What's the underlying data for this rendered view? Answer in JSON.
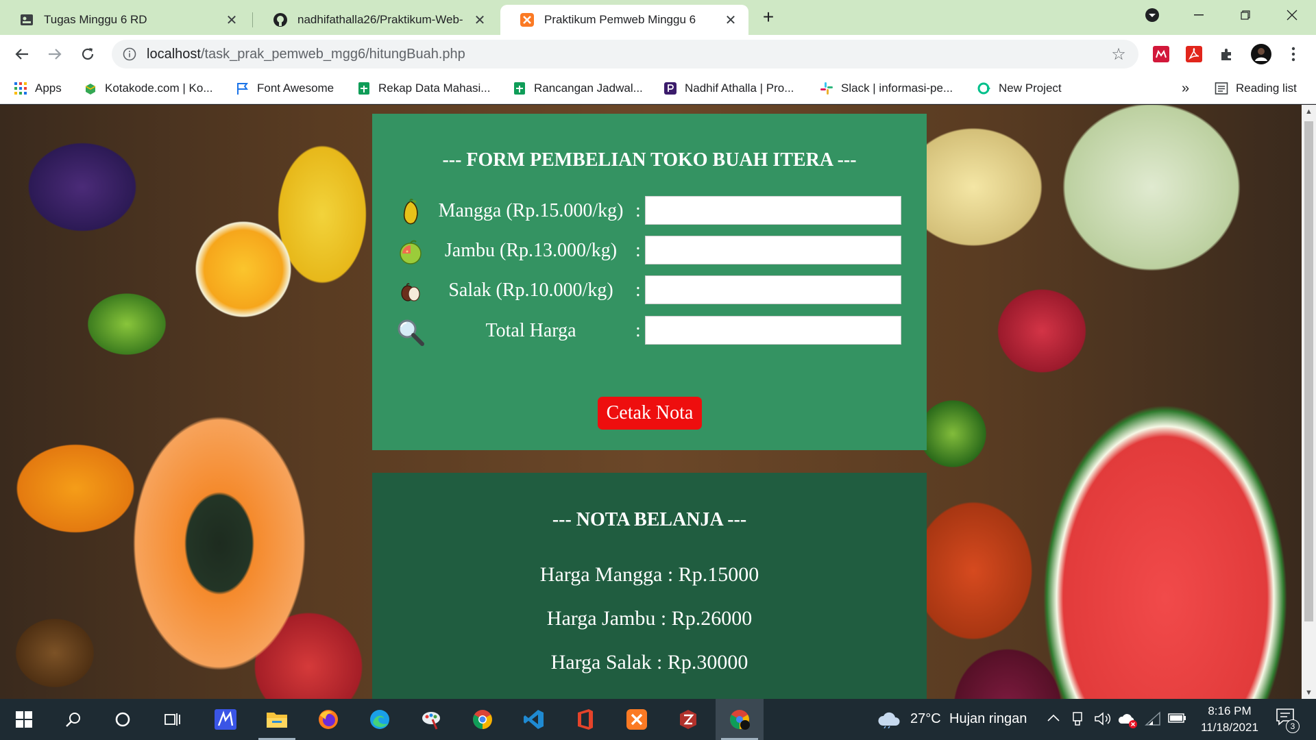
{
  "browser": {
    "tabs": [
      {
        "title": "Tugas Minggu 6 RD",
        "active": false
      },
      {
        "title": "nadhifathalla26/Praktikum-Web-",
        "active": false
      },
      {
        "title": "Praktikum Pemweb Minggu 6",
        "active": true
      }
    ],
    "new_tab_symbol": "+",
    "address": {
      "host": "localhost",
      "path": "/task_prak_pemweb_mgg6/hitungBuah.php"
    },
    "bookmarks": [
      {
        "label": "Apps",
        "icon": "apps-grid-icon"
      },
      {
        "label": "Kotakode.com | Ko...",
        "icon": "kotakode-icon"
      },
      {
        "label": "Font Awesome",
        "icon": "font-awesome-flag-icon"
      },
      {
        "label": "Rekap Data Mahasi...",
        "icon": "google-sheets-icon"
      },
      {
        "label": "Rancangan Jadwal...",
        "icon": "google-sheets-icon"
      },
      {
        "label": "Nadhif Athalla | Pro...",
        "icon": "profile-p-icon"
      },
      {
        "label": "Slack | informasi-pe...",
        "icon": "slack-icon"
      },
      {
        "label": "New Project",
        "icon": "new-project-icon"
      }
    ],
    "bookmarks_overflow": "»",
    "reading_list": "Reading list"
  },
  "page": {
    "form": {
      "title": "--- FORM PEMBELIAN TOKO BUAH ITERA ---",
      "rows": [
        {
          "label": "Mangga (Rp.15.000/kg)",
          "icon": "mango-icon",
          "value": ""
        },
        {
          "label": "Jambu (Rp.13.000/kg)",
          "icon": "guava-icon",
          "value": ""
        },
        {
          "label": "Salak (Rp.10.000/kg)",
          "icon": "snake-fruit-icon",
          "value": ""
        },
        {
          "label": "Total Harga",
          "icon": "magnifier-icon",
          "value": ""
        }
      ],
      "colon": ":",
      "button": "Cetak Nota"
    },
    "nota": {
      "title": "--- NOTA BELANJA ---",
      "lines": [
        "Harga Mangga : Rp.15000",
        "Harga Jambu : Rp.26000",
        "Harga Salak : Rp.30000"
      ]
    }
  },
  "taskbar": {
    "weather": {
      "temp": "27°C",
      "desc": "Hujan ringan"
    },
    "time": "8:16 PM",
    "date": "11/18/2021",
    "notification_count": "3"
  },
  "colors": {
    "form_panel": "#349362",
    "nota_panel": "#205d40",
    "cetak_button": "#ee0e0e",
    "tab_strip": "#cfe8c5"
  }
}
